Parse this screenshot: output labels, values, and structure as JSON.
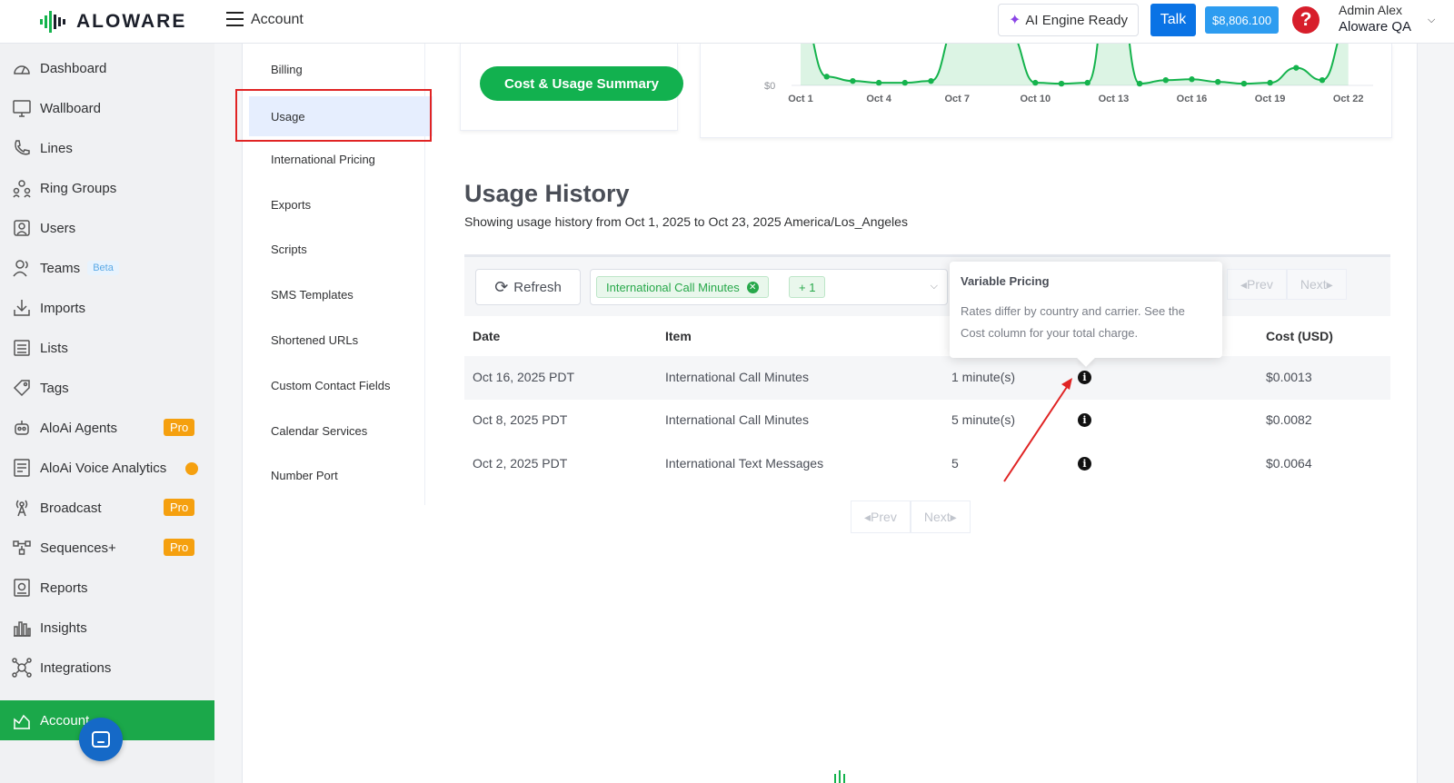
{
  "topbar": {
    "brand": "ALOWARE",
    "page_title": "Account",
    "ai_status": "AI Engine Ready",
    "talk_label": "Talk",
    "balance": "$8,806.100",
    "help_glyph": "?",
    "user_name": "Admin Alex",
    "user_company": "Aloware QA"
  },
  "sidebar": {
    "items": [
      {
        "label": "Dashboard",
        "icon": "dashboard-icon"
      },
      {
        "label": "Wallboard",
        "icon": "monitor-icon"
      },
      {
        "label": "Lines",
        "icon": "phone-icon"
      },
      {
        "label": "Ring Groups",
        "icon": "ring-groups-icon"
      },
      {
        "label": "Users",
        "icon": "users-icon"
      },
      {
        "label": "Teams",
        "icon": "teams-icon",
        "badge": "Beta"
      },
      {
        "label": "Imports",
        "icon": "import-icon"
      },
      {
        "label": "Lists",
        "icon": "list-icon"
      },
      {
        "label": "Tags",
        "icon": "tag-icon"
      },
      {
        "label": "AloAi Agents",
        "icon": "robot-icon",
        "badge": "Pro"
      },
      {
        "label": "AloAi Voice Analytics",
        "icon": "analytics-icon"
      },
      {
        "label": "Broadcast",
        "icon": "broadcast-icon",
        "badge": "Pro"
      },
      {
        "label": "Sequences+",
        "icon": "sequences-icon",
        "badge": "Pro"
      },
      {
        "label": "Reports",
        "icon": "reports-icon"
      },
      {
        "label": "Insights",
        "icon": "insights-icon"
      },
      {
        "label": "Integrations",
        "icon": "integrations-icon"
      },
      {
        "label": "Account",
        "icon": "account-icon",
        "active": true
      }
    ]
  },
  "submenu": {
    "items": [
      "Billing",
      "Usage",
      "International Pricing",
      "Exports",
      "Scripts",
      "SMS Templates",
      "Shortened URLs",
      "Custom Contact Fields",
      "Calendar Services",
      "Number Port"
    ],
    "selected": "Usage"
  },
  "summary": {
    "button_label": "Cost & Usage Summary"
  },
  "chart_data": {
    "type": "area",
    "x": [
      "Oct 1",
      "Oct 2",
      "Oct 3",
      "Oct 4",
      "Oct 5",
      "Oct 6",
      "Oct 7",
      "Oct 8",
      "Oct 9",
      "Oct 10",
      "Oct 11",
      "Oct 12",
      "Oct 13",
      "Oct 14",
      "Oct 15",
      "Oct 16",
      "Oct 17",
      "Oct 18",
      "Oct 19",
      "Oct 20",
      "Oct 21",
      "Oct 22"
    ],
    "xticks": [
      "Oct 1",
      "Oct 4",
      "Oct 7",
      "Oct 10",
      "Oct 13",
      "Oct 16",
      "Oct 19",
      "Oct 22"
    ],
    "values": [
      8.5,
      1.0,
      0.5,
      0.3,
      0.3,
      0.5,
      7.0,
      15,
      6.0,
      0.3,
      0.2,
      0.3,
      16,
      0.2,
      0.6,
      0.7,
      0.4,
      0.2,
      0.3,
      2.0,
      0.6,
      7.0
    ],
    "y_label_visible": "$0",
    "ylim": [
      0,
      12
    ],
    "color": "#15b34d"
  },
  "usage_history": {
    "title": "Usage History",
    "subtitle": "Showing usage history from Oct 1, 2025 to Oct 23, 2025 America/Los_Angeles",
    "refresh_label": "Refresh",
    "filter_tag": "International Call Minutes",
    "filter_more": "+ 1",
    "prev_label": "Prev",
    "next_label": "Next",
    "columns": [
      "Date",
      "Item",
      "Cost (USD)"
    ],
    "rows": [
      {
        "date": "Oct 16, 2025 PDT",
        "item": "International Call Minutes",
        "qty": "1 minute(s)",
        "cost": "$0.0013"
      },
      {
        "date": "Oct 8, 2025 PDT",
        "item": "International Call Minutes",
        "qty": "5 minute(s)",
        "cost": "$0.0082"
      },
      {
        "date": "Oct 2, 2025 PDT",
        "item": "International Text Messages",
        "qty": "5",
        "cost": "$0.0064"
      }
    ]
  },
  "tooltip": {
    "title": "Variable Pricing",
    "body": "Rates differ by country and carrier. See the Cost column for your total charge."
  },
  "colors": {
    "primary_green": "#1ba84a",
    "talk_blue": "#0a73e5",
    "balance_blue": "#2d9cf0",
    "pro_orange": "#f5a00f",
    "annotation_red": "#e02424"
  }
}
